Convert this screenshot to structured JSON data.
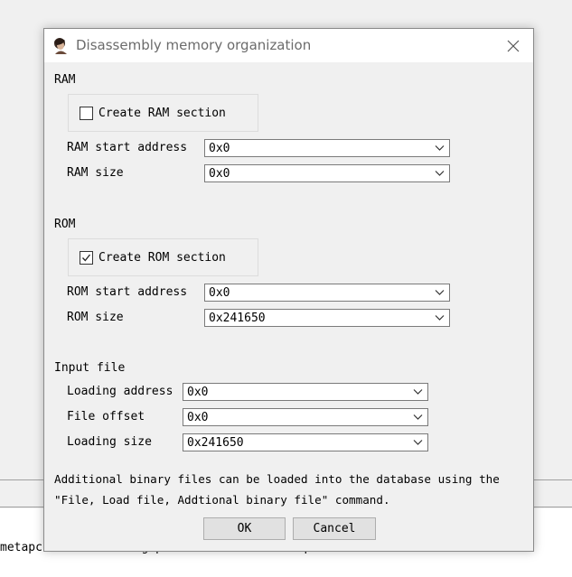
{
  "dialog": {
    "title": "Disassembly memory organization",
    "ram": {
      "section_label": "RAM",
      "create_label": "Create RAM section",
      "create_checked": false,
      "start_label": "RAM start address",
      "start_value": "0x0",
      "size_label": "RAM size",
      "size_value": "0x0"
    },
    "rom": {
      "section_label": "ROM",
      "create_label": "Create ROM section",
      "create_checked": true,
      "start_label": "ROM start address",
      "start_value": "0x0",
      "size_label": "ROM size",
      "size_value": "0x241650"
    },
    "input_file": {
      "section_label": "Input file",
      "loading_address_label": "Loading address",
      "loading_address_value": "0x0",
      "file_offset_label": "File offset",
      "file_offset_value": "0x0",
      "loading_size_label": "Loading size",
      "loading_size_value": "0x241650"
    },
    "info_line1": "Additional binary files can be loaded into the database using the",
    "info_line2": "\"File, Load file, Addtional binary file\" command.",
    "ok_label": "OK",
    "cancel_label": "Cancel"
  },
  "background": {
    "output_line": "metapc...Initializing processor module metapc...OK"
  },
  "icons": {
    "title": "ida-app-icon",
    "close": "close-icon",
    "dropdown": "chevron-down-icon",
    "check": "check-icon"
  }
}
